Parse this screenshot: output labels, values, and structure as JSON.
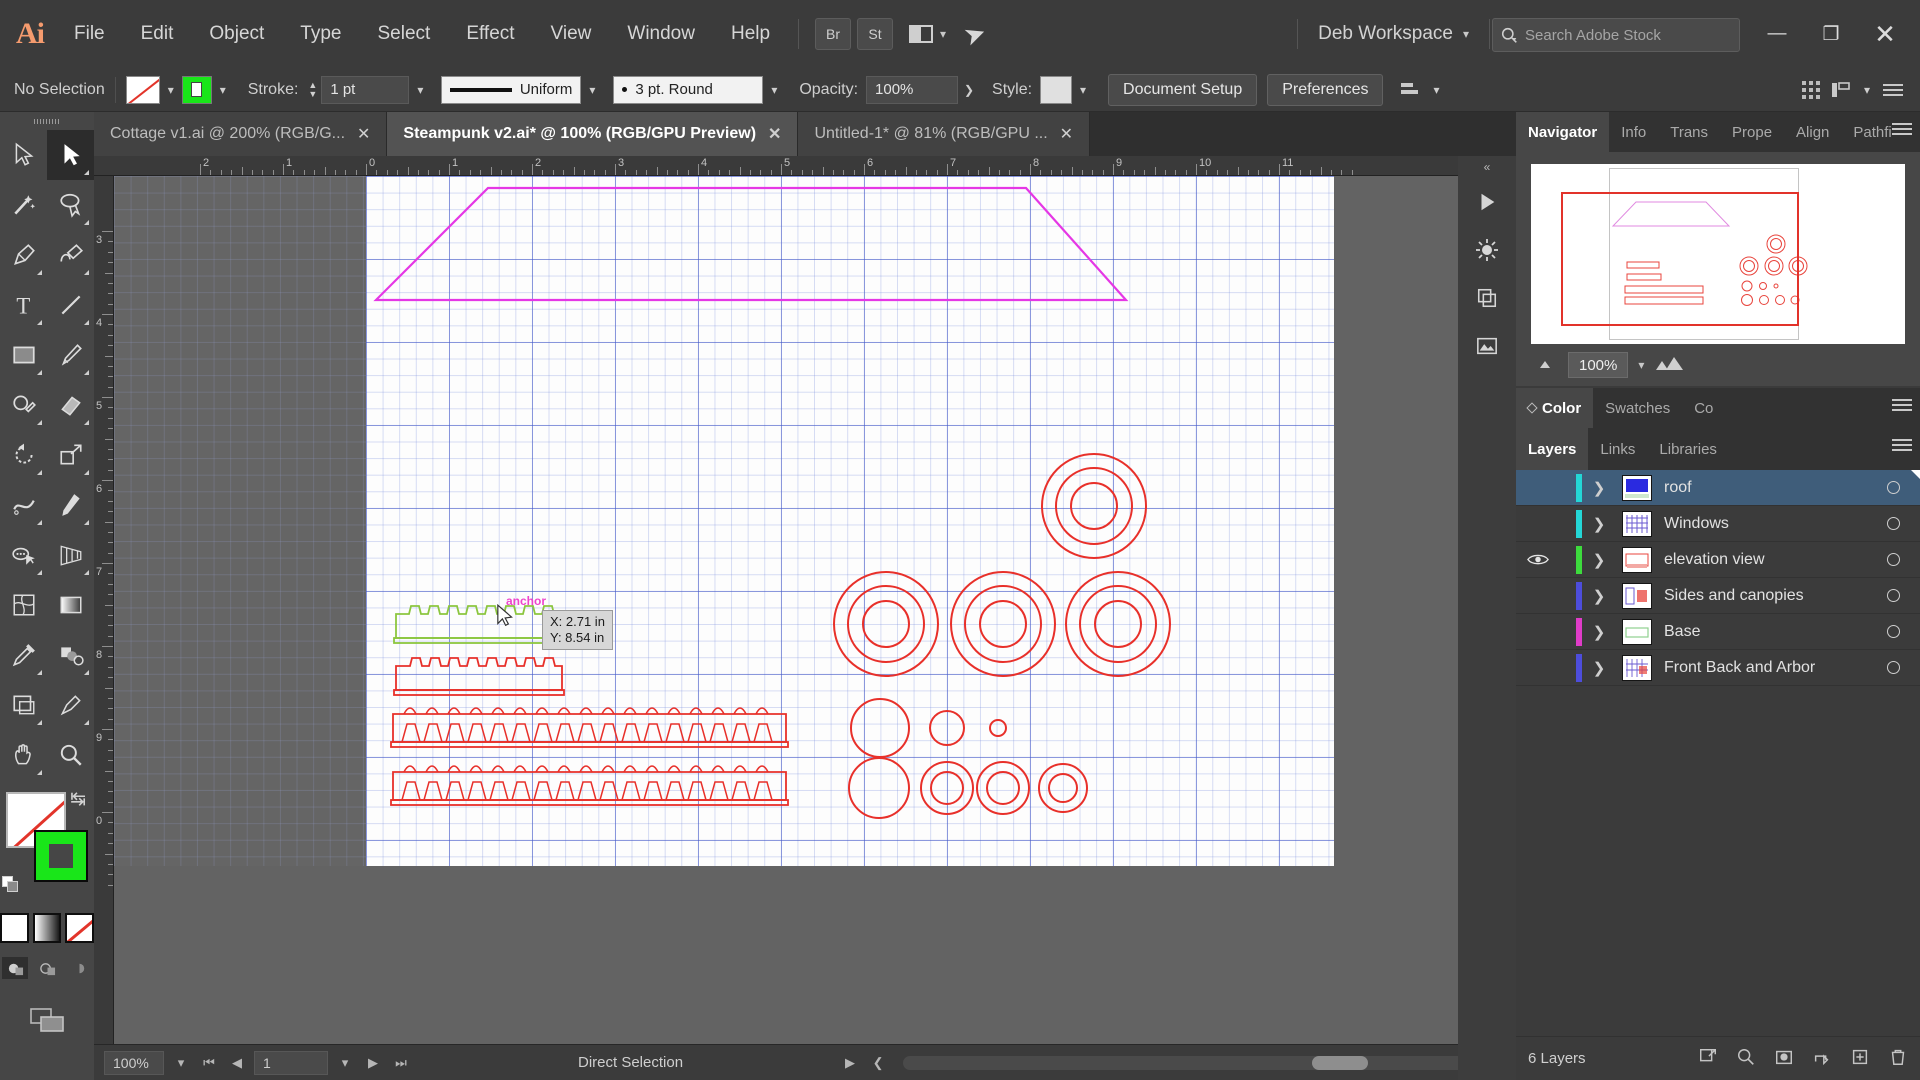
{
  "app": {
    "logo": "Ai",
    "menus": [
      "File",
      "Edit",
      "Object",
      "Type",
      "Select",
      "Effect",
      "View",
      "Window",
      "Help"
    ],
    "bridge_label": "Br",
    "stock_label": "St",
    "workspace_name": "Deb Workspace",
    "search_placeholder": "Search Adobe Stock",
    "window_minimize": "—",
    "window_maximize": "❐",
    "window_close": "✕"
  },
  "control_bar": {
    "selection_status": "No Selection",
    "fill_swatch": "none",
    "stroke_swatch_color": "#19e619",
    "stroke_label": "Stroke:",
    "stroke_weight": "1 pt",
    "profile_label": "Uniform",
    "brush_label": "3 pt. Round",
    "opacity_label": "Opacity:",
    "opacity_value": "100%",
    "style_label": "Style:",
    "document_setup": "Document Setup",
    "preferences": "Preferences"
  },
  "document_tabs": [
    {
      "title": "Cottage v1.ai @ 200% (RGB/G...",
      "active": false,
      "closable": true
    },
    {
      "title": "Steampunk v2.ai* @ 100% (RGB/GPU Preview)",
      "active": true,
      "closable": true
    },
    {
      "title": "Untitled-1* @ 81% (RGB/GPU ...",
      "active": false,
      "closable": true
    }
  ],
  "tools": [
    {
      "name": "selection-tool",
      "glyph": "arrow-outline"
    },
    {
      "name": "direct-selection-tool",
      "glyph": "arrow-solid",
      "active": true
    },
    {
      "name": "magic-wand-tool",
      "glyph": "wand"
    },
    {
      "name": "lasso-tool",
      "glyph": "lasso"
    },
    {
      "name": "pen-tool",
      "glyph": "pen"
    },
    {
      "name": "curvature-tool",
      "glyph": "curvature"
    },
    {
      "name": "type-tool",
      "glyph": "type"
    },
    {
      "name": "line-segment-tool",
      "glyph": "line"
    },
    {
      "name": "rectangle-tool",
      "glyph": "rect"
    },
    {
      "name": "paintbrush-tool",
      "glyph": "brush"
    },
    {
      "name": "shaper-tool",
      "glyph": "shaper"
    },
    {
      "name": "eraser-tool",
      "glyph": "eraser"
    },
    {
      "name": "rotate-tool",
      "glyph": "rotate"
    },
    {
      "name": "scale-tool",
      "glyph": "scale"
    },
    {
      "name": "width-tool",
      "glyph": "width"
    },
    {
      "name": "free-transform-tool",
      "glyph": "freetransform"
    },
    {
      "name": "shape-builder-tool",
      "glyph": "shapebuilder"
    },
    {
      "name": "perspective-grid-tool",
      "glyph": "perspective"
    },
    {
      "name": "mesh-tool",
      "glyph": "mesh"
    },
    {
      "name": "gradient-tool",
      "glyph": "gradient"
    },
    {
      "name": "eyedropper-tool",
      "glyph": "eyedropper"
    },
    {
      "name": "blend-tool",
      "glyph": "blend"
    },
    {
      "name": "artboard-tool",
      "glyph": "artboard"
    },
    {
      "name": "slice-tool",
      "glyph": "slice"
    },
    {
      "name": "hand-tool",
      "glyph": "hand"
    },
    {
      "name": "zoom-tool",
      "glyph": "zoom"
    }
  ],
  "canvas": {
    "ruler_h_labels": [
      "2",
      "1",
      "0",
      "1",
      "2",
      "3",
      "4",
      "5",
      "6",
      "7",
      "8",
      "9",
      "10",
      "11"
    ],
    "ruler_v_labels": [
      "3",
      "4",
      "5",
      "6",
      "7",
      "8",
      "9",
      "0"
    ],
    "anchor_label": "anchor",
    "tooltip_x": "X: 2.71 in",
    "tooltip_y": "Y: 8.54 in",
    "roof_stroke_color": "#e537e5",
    "art_stroke_color": "#e8302a",
    "selected_stroke_color": "#8cc63f"
  },
  "status_bar": {
    "zoom_level": "100%",
    "artboard_number": "1",
    "tool_mode": "Direct Selection"
  },
  "right_dock": {
    "panel_tabs_top": [
      "Navigator",
      "Info",
      "Trans",
      "Prope",
      "Align",
      "Pathfi"
    ],
    "panel_tabs_top_active": "Navigator",
    "navigator_zoom": "100%",
    "color_tabs": [
      "Color",
      "Swatches",
      "Co"
    ],
    "color_tabs_active": "Color",
    "layers_tabs": [
      "Layers",
      "Links",
      "Libraries"
    ],
    "layers_tabs_active": "Layers",
    "layers": [
      {
        "name": "roof",
        "color": "#24d6d6",
        "selected": true,
        "visible": false,
        "thumb": "roof"
      },
      {
        "name": "Windows",
        "color": "#24d6d6",
        "selected": false,
        "visible": false,
        "thumb": "windows"
      },
      {
        "name": "elevation view",
        "color": "#3ddb3d",
        "selected": false,
        "visible": true,
        "thumb": "elevation"
      },
      {
        "name": "Sides and canopies",
        "color": "#4d4ddb",
        "selected": false,
        "visible": false,
        "thumb": "sides"
      },
      {
        "name": "Base",
        "color": "#e03cc8",
        "selected": false,
        "visible": false,
        "thumb": "base"
      },
      {
        "name": "Front Back and Arbor",
        "color": "#4d4ddb",
        "selected": false,
        "visible": false,
        "thumb": "front"
      }
    ],
    "layers_count": "6 Layers"
  },
  "dock_strip_icons": [
    "play-icon",
    "sun-icon",
    "layers-stack-icon",
    "image-icon"
  ]
}
